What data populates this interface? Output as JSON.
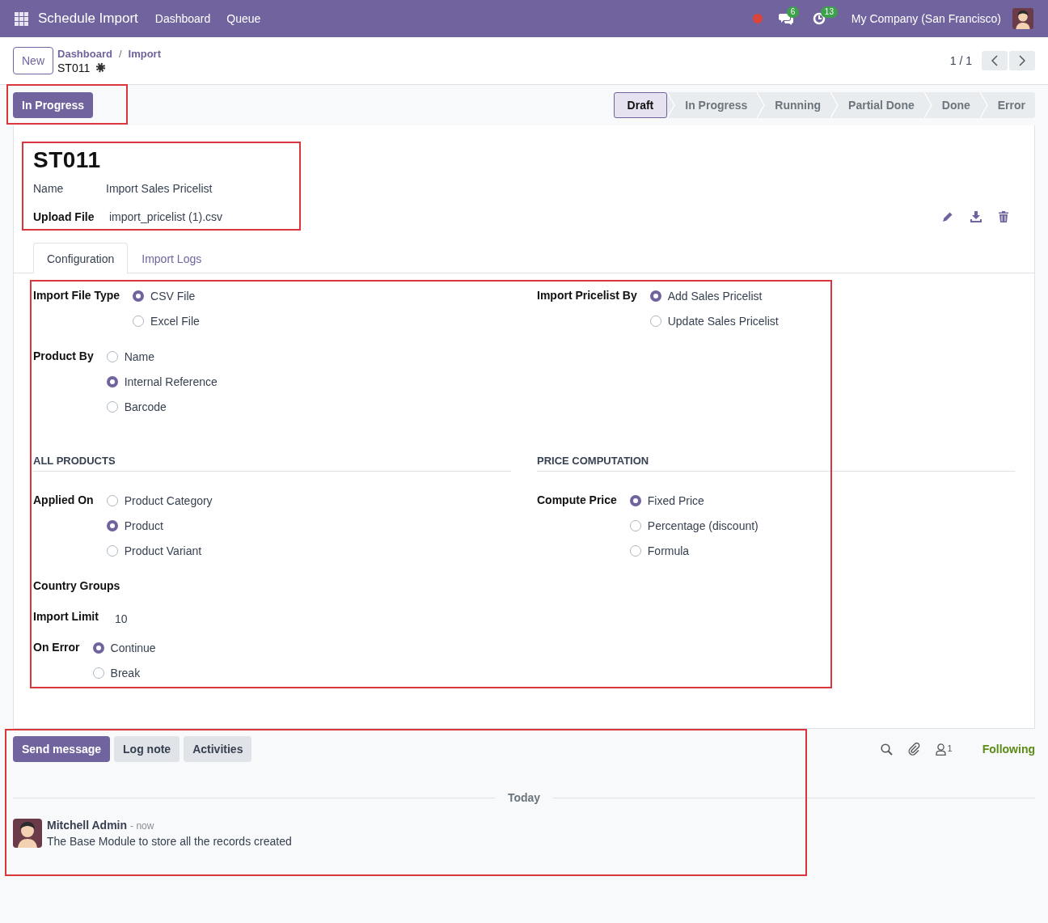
{
  "navbar": {
    "app_title": "Schedule Import",
    "menu": [
      {
        "label": "Dashboard"
      },
      {
        "label": "Queue"
      }
    ],
    "messages_badge": "6",
    "activities_badge": "13",
    "company": "My Company (San Francisco)"
  },
  "control_panel": {
    "new_button": "New",
    "breadcrumbs": [
      "Dashboard",
      "Import"
    ],
    "breadcrumb_separator": "/",
    "record_name": "ST011",
    "pager": "1 / 1"
  },
  "status_bar": {
    "action_button": "In Progress",
    "stages": [
      {
        "label": "Draft",
        "selected": true
      },
      {
        "label": "In Progress",
        "selected": false
      },
      {
        "label": "Running",
        "selected": false
      },
      {
        "label": "Partial Done",
        "selected": false
      },
      {
        "label": "Done",
        "selected": false
      },
      {
        "label": "Error",
        "selected": false
      }
    ]
  },
  "form": {
    "title": "ST011",
    "fields": [
      {
        "kind": "text",
        "label": "Name",
        "value": "Import Sales Pricelist"
      },
      {
        "kind": "file",
        "label": "Upload File",
        "value": "import_pricelist (1).csv"
      }
    ],
    "tabs": [
      {
        "label": "Configuration",
        "selected": true
      },
      {
        "label": "Import Logs",
        "selected": false
      }
    ],
    "sections": [
      {
        "left": {
          "rows": [
            {
              "kind": "radio",
              "label": "Import File Type",
              "options": [
                {
                  "label": "CSV File",
                  "selected": true
                },
                {
                  "label": "Excel File",
                  "selected": false
                }
              ]
            },
            {
              "kind": "radio",
              "label": "Product By",
              "options": [
                {
                  "label": "Name",
                  "selected": false
                },
                {
                  "label": "Internal Reference",
                  "selected": true
                },
                {
                  "label": "Barcode",
                  "selected": false
                }
              ]
            }
          ]
        },
        "right": {
          "rows": [
            {
              "kind": "radio",
              "label": "Import Pricelist By",
              "options": [
                {
                  "label": "Add Sales Pricelist",
                  "selected": true
                },
                {
                  "label": "Update Sales Pricelist",
                  "selected": false
                }
              ]
            }
          ]
        }
      },
      {
        "left": {
          "title": "ALL PRODUCTS",
          "rows": [
            {
              "kind": "radio",
              "label": "Applied On",
              "options": [
                {
                  "label": "Product Category",
                  "selected": false
                },
                {
                  "label": "Product",
                  "selected": true
                },
                {
                  "label": "Product Variant",
                  "selected": false
                }
              ]
            },
            {
              "kind": "empty",
              "label": "Country Groups"
            },
            {
              "kind": "text",
              "label": "Import Limit",
              "value": "10"
            },
            {
              "kind": "radio",
              "label": "On Error",
              "options": [
                {
                  "label": "Continue",
                  "selected": true
                },
                {
                  "label": "Break",
                  "selected": false
                }
              ]
            }
          ]
        },
        "right": {
          "title": "PRICE COMPUTATION",
          "rows": [
            {
              "kind": "radio",
              "label": "Compute Price",
              "options": [
                {
                  "label": "Fixed Price",
                  "selected": true
                },
                {
                  "label": "Percentage (discount)",
                  "selected": false
                },
                {
                  "label": "Formula",
                  "selected": false
                }
              ]
            }
          ]
        }
      }
    ]
  },
  "chatter": {
    "buttons": [
      {
        "label": "Send message",
        "kind": "primary"
      },
      {
        "label": "Log note",
        "kind": "secondary"
      },
      {
        "label": "Activities",
        "kind": "secondary"
      }
    ],
    "followers_count": "1",
    "follow_button": "Following",
    "date_separator": "Today",
    "messages": [
      {
        "author": "Mitchell Admin",
        "time": "- now",
        "body": "The Base Module to store all the records created"
      }
    ]
  }
}
